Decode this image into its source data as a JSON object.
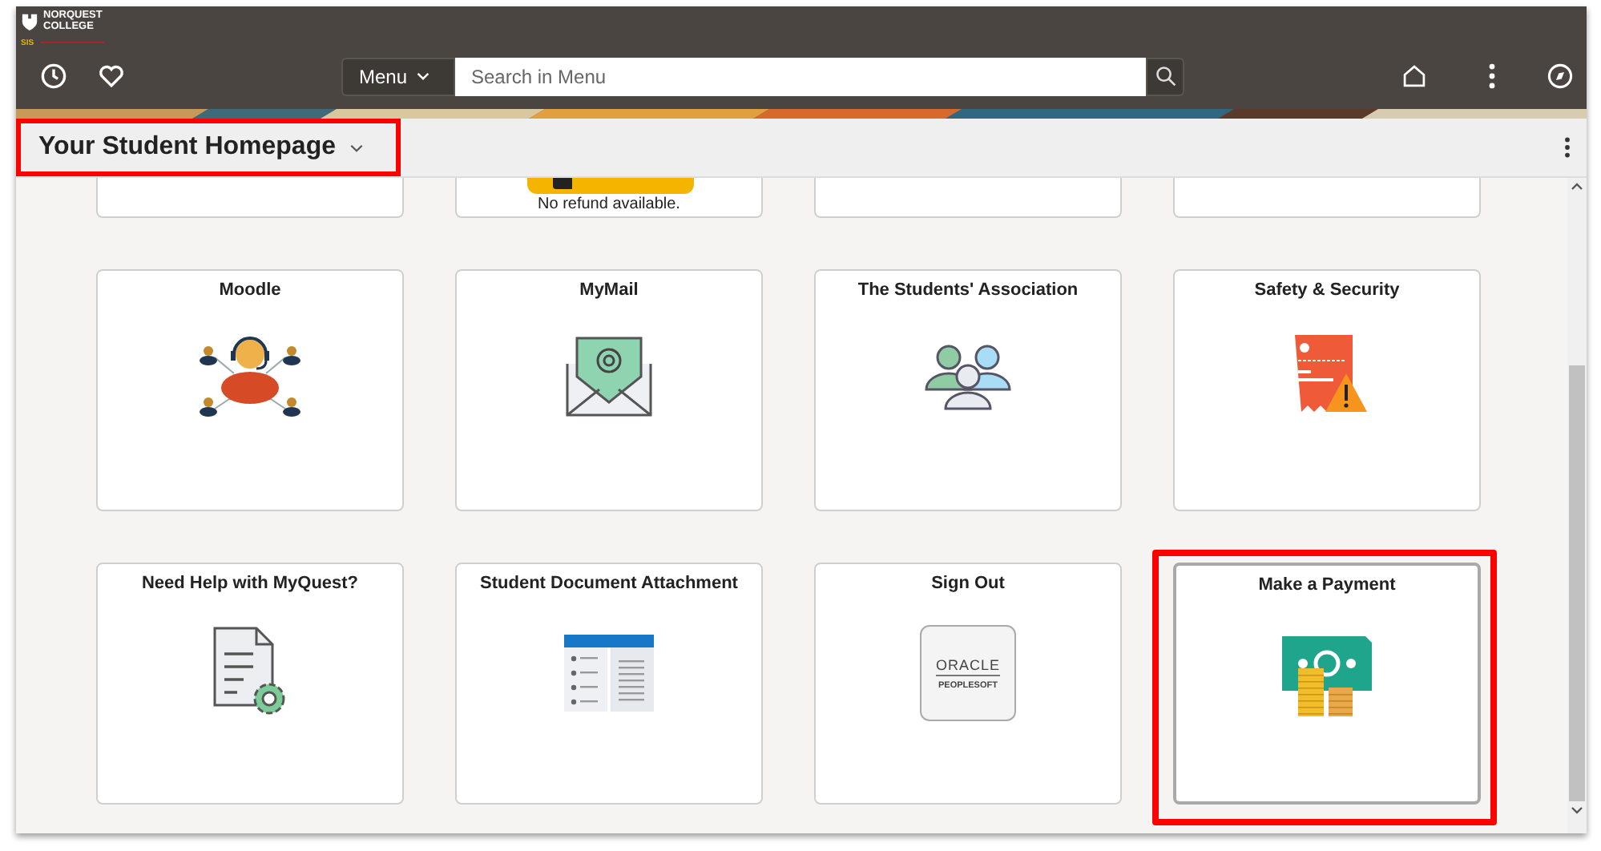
{
  "header": {
    "logo": {
      "name_lines": [
        "NORQUEST",
        "COLLEGE"
      ],
      "tag": "SIS"
    },
    "menu_button": "Menu",
    "search": {
      "placeholder": "Search in Menu"
    }
  },
  "page_title": {
    "text": "Your Student Homepage",
    "highlighted": true
  },
  "partial_tiles": [
    {
      "kind": "blank"
    },
    {
      "kind": "notice",
      "caption": "No refund available."
    },
    {
      "kind": "blank"
    },
    {
      "kind": "blank"
    }
  ],
  "tiles": [
    {
      "title": "Moodle",
      "kind": "support",
      "highlighted": false
    },
    {
      "title": "MyMail",
      "kind": "mail",
      "highlighted": false
    },
    {
      "title": "The Students' Association",
      "kind": "people",
      "highlighted": false
    },
    {
      "title": "Safety & Security",
      "kind": "alert",
      "highlighted": false
    },
    {
      "title": "Need Help with MyQuest?",
      "kind": "document",
      "highlighted": false
    },
    {
      "title": "Student Document Attachment",
      "kind": "list",
      "highlighted": false
    },
    {
      "title": "Sign Out",
      "kind": "brand",
      "badge": [
        "ORACLE",
        "PEOPLESOFT"
      ],
      "highlighted": false
    },
    {
      "title": "Make a Payment",
      "kind": "money",
      "highlighted": true
    }
  ]
}
